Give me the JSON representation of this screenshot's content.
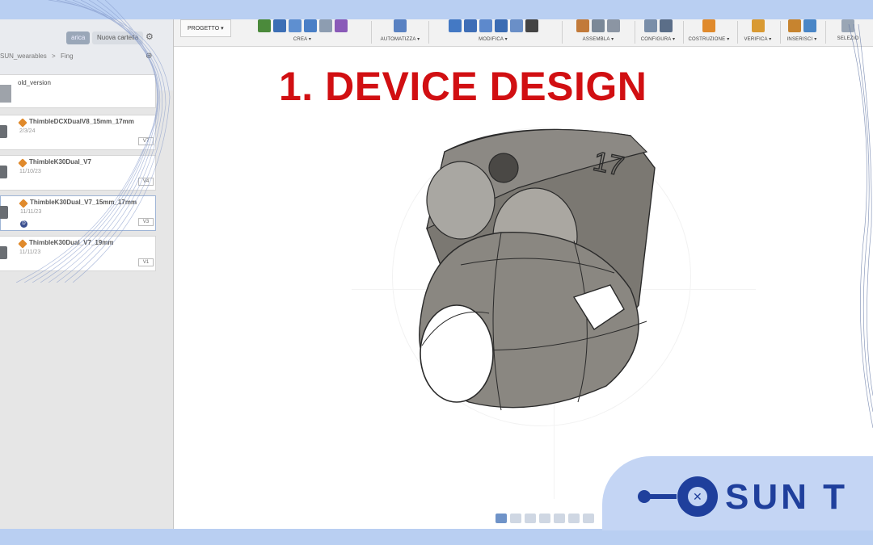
{
  "panel": {
    "upload_label": "arica",
    "new_folder_label": "Nuova cartella",
    "breadcrumb": [
      "SUN_wearables",
      ">",
      "Fing"
    ],
    "folder": {
      "name": "old_version"
    },
    "files": [
      {
        "name": "ThimbleDCXDualV8_15mm_17mm",
        "date": "2/3/24",
        "version": "V7",
        "badge": ""
      },
      {
        "name": "ThimbleK30Dual_V7",
        "date": "11/10/23",
        "version": "V4",
        "badge": ""
      },
      {
        "name": "ThimbleK30Dual_V7_15mm_17mm",
        "date": "11/11/23",
        "version": "V3",
        "badge": "D"
      },
      {
        "name": "ThimbleK30Dual_V7_19mm",
        "date": "11/11/23",
        "version": "V1",
        "badge": ""
      }
    ]
  },
  "toolbar": {
    "workspace": "PROGETTO",
    "groups": [
      "CREA",
      "AUTOMATIZZA",
      "MODIFICA",
      "ASSEMBLA",
      "CONFIGURA",
      "COSTRUZIONE",
      "VERIFICA",
      "INSERISCI",
      "SELEZIO"
    ]
  },
  "slide": {
    "title": "1. DEVICE DESIGN"
  },
  "model": {
    "label": "17"
  },
  "brand": {
    "text": "SUN T"
  },
  "colors": {
    "title_red": "#d10f12",
    "brand_blue": "#1f3f9c",
    "frame_blue": "#b9cff2",
    "model_gray": "#7a7772"
  }
}
